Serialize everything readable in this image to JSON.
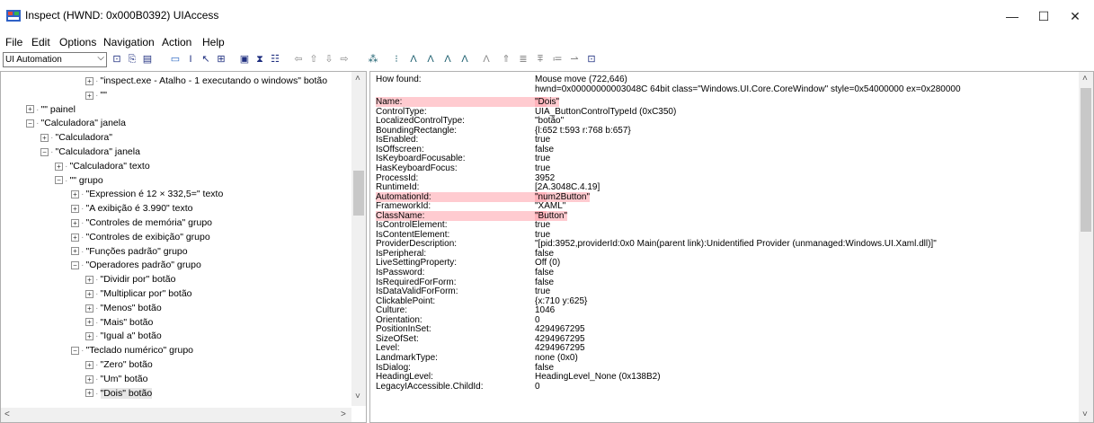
{
  "window": {
    "title": "Inspect  (HWND: 0x000B0392) UIAccess",
    "minimize": "—",
    "maximize": "☐",
    "close": "✕"
  },
  "menu": [
    "File",
    "Edit",
    "Options",
    "Navigation",
    "Action",
    "Help"
  ],
  "toolbar": {
    "mode_select": "UI Automation",
    "icons": [
      "refresh-icon",
      "copy-icon",
      "properties-icon",
      "highlight-rect-icon",
      "text-cursor-icon",
      "pointer-icon",
      "watch-cursor-icon",
      "focus-icon",
      "caret-icon",
      "options-icon",
      "back-arrow-icon",
      "up-arrow-icon",
      "down-arrow-icon",
      "forward-arrow-icon",
      "tree-icon",
      "pattern-1-icon",
      "pattern-2-icon",
      "pattern-3-icon",
      "pattern-4-icon",
      "pattern-5-icon",
      "pattern-6-icon",
      "pattern-7-icon",
      "pattern-8-icon",
      "pattern-9-icon",
      "pattern-10-icon",
      "pattern-11-icon",
      "pattern-12-icon"
    ]
  },
  "tree": [
    {
      "label": "\"inspect.exe - Atalho - 1 executando o windows\" botão",
      "indent": 5
    },
    {
      "label": "\"\"",
      "indent": 5
    },
    {
      "label": "\"\" painel",
      "indent": 1
    },
    {
      "label": "\"Calculadora\" janela",
      "indent": 1
    },
    {
      "label": "\"Calculadora\"",
      "indent": 2
    },
    {
      "label": "\"Calculadora\" janela",
      "indent": 2
    },
    {
      "label": "\"Calculadora\" texto",
      "indent": 3
    },
    {
      "label": "\"\" grupo",
      "indent": 3
    },
    {
      "label": "\"Expression é 12 × 332,5=\" texto",
      "indent": 4
    },
    {
      "label": "\"A exibição é 3.990\" texto",
      "indent": 4
    },
    {
      "label": "\"Controles de memória\" grupo",
      "indent": 4
    },
    {
      "label": "\"Controles de exibição\" grupo",
      "indent": 4
    },
    {
      "label": "\"Funções padrão\" grupo",
      "indent": 4
    },
    {
      "label": "\"Operadores padrão\" grupo",
      "indent": 4
    },
    {
      "label": "\"Dividir por\" botão",
      "indent": 5
    },
    {
      "label": "\"Multiplicar por\" botão",
      "indent": 5
    },
    {
      "label": "\"Menos\" botão",
      "indent": 5
    },
    {
      "label": "\"Mais\" botão",
      "indent": 5
    },
    {
      "label": "\"Igual a\" botão",
      "indent": 5
    },
    {
      "label": "\"Teclado numérico\" grupo",
      "indent": 4
    },
    {
      "label": "\"Zero\" botão",
      "indent": 5
    },
    {
      "label": "\"Um\" botão",
      "indent": 5
    },
    {
      "label": "\"Dois\" botão",
      "indent": 5
    }
  ],
  "properties": [
    {
      "k": "How found:",
      "v": "Mouse move (722,646)"
    },
    {
      "k": "",
      "v": "hwnd=0x00000000003048C 64bit class=\"Windows.UI.Core.CoreWindow\" style=0x54000000 ex=0x280000"
    },
    {
      "k": "Name:",
      "v": "\"Dois\"",
      "hl": true
    },
    {
      "k": "ControlType:",
      "v": "UIA_ButtonControlTypeId (0xC350)"
    },
    {
      "k": "LocalizedControlType:",
      "v": "\"botão\""
    },
    {
      "k": "BoundingRectangle:",
      "v": "{l:652 t:593 r:768 b:657}"
    },
    {
      "k": "IsEnabled:",
      "v": "true"
    },
    {
      "k": "IsOffscreen:",
      "v": "false"
    },
    {
      "k": "IsKeyboardFocusable:",
      "v": "true"
    },
    {
      "k": "HasKeyboardFocus:",
      "v": "true"
    },
    {
      "k": "ProcessId:",
      "v": "3952"
    },
    {
      "k": "RuntimeId:",
      "v": "[2A.3048C.4.19]"
    },
    {
      "k": "AutomationId:",
      "v": "\"num2Button\"",
      "hl": true
    },
    {
      "k": "FrameworkId:",
      "v": "\"XAML\""
    },
    {
      "k": "ClassName:",
      "v": "\"Button\"",
      "hl": true
    },
    {
      "k": "IsControlElement:",
      "v": "true"
    },
    {
      "k": "IsContentElement:",
      "v": "true"
    },
    {
      "k": "ProviderDescription:",
      "v": "\"[pid:3952,providerId:0x0 Main(parent link):Unidentified Provider (unmanaged:Windows.UI.Xaml.dll)]\""
    },
    {
      "k": "IsPeripheral:",
      "v": "false"
    },
    {
      "k": "LiveSettingProperty:",
      "v": "Off (0)"
    },
    {
      "k": "IsPassword:",
      "v": "false"
    },
    {
      "k": "IsRequiredForForm:",
      "v": "false"
    },
    {
      "k": "IsDataValidForForm:",
      "v": "true"
    },
    {
      "k": "ClickablePoint:",
      "v": "{x:710 y:625}"
    },
    {
      "k": "Culture:",
      "v": "1046"
    },
    {
      "k": "Orientation:",
      "v": "0"
    },
    {
      "k": "PositionInSet:",
      "v": "4294967295"
    },
    {
      "k": "SizeOfSet:",
      "v": "4294967295"
    },
    {
      "k": "Level:",
      "v": "4294967295"
    },
    {
      "k": "LandmarkType:",
      "v": "none (0x0)"
    },
    {
      "k": "IsDialog:",
      "v": "false"
    },
    {
      "k": "HeadingLevel:",
      "v": "HeadingLevel_None (0x138B2)"
    },
    {
      "k": "LegacyIAccessible.ChildId:",
      "v": "0"
    }
  ]
}
